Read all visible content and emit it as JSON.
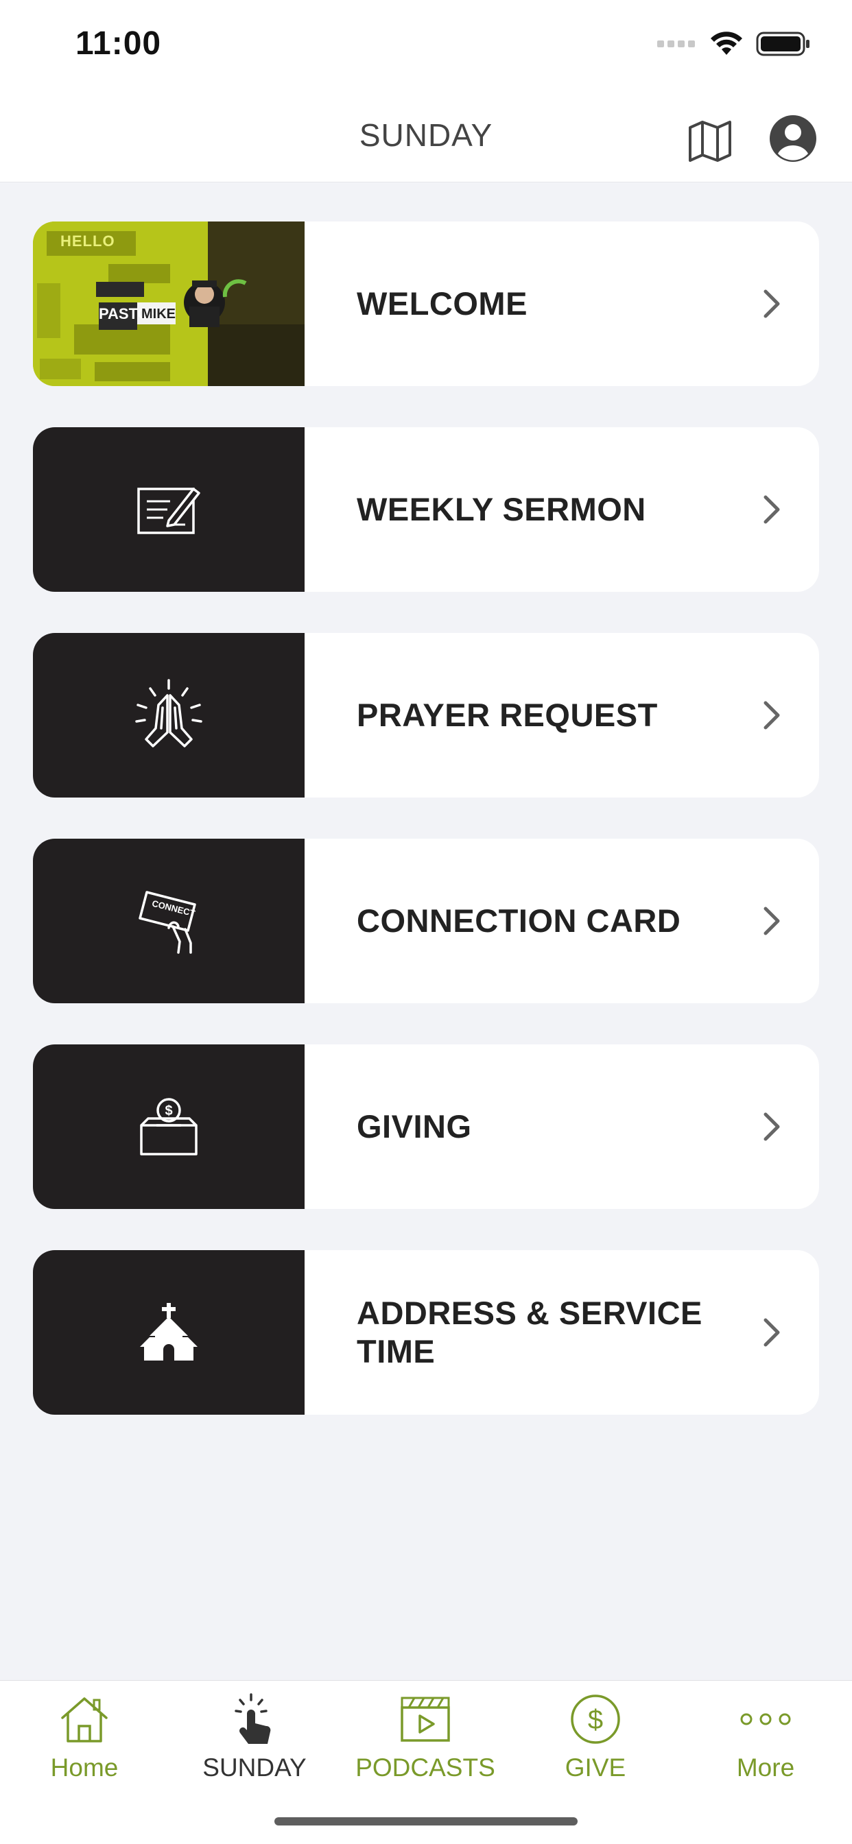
{
  "status_bar": {
    "time": "11:00"
  },
  "nav": {
    "title": "SUNDAY"
  },
  "menu": {
    "items": [
      {
        "label": "WELCOME",
        "icon": "welcome-video-thumbnail"
      },
      {
        "label": "WEEKLY SERMON",
        "icon": "notepad-pen-icon"
      },
      {
        "label": "PRAYER REQUEST",
        "icon": "praying-hands-icon"
      },
      {
        "label": "CONNECTION CARD",
        "icon": "connect-card-icon"
      },
      {
        "label": "GIVING",
        "icon": "donation-box-icon"
      },
      {
        "label": "ADDRESS & SERVICE TIME",
        "icon": "church-icon"
      }
    ],
    "welcome_thumbnail": {
      "word": "HELLO",
      "pastor": "PASTOR",
      "name": "MIKE"
    }
  },
  "tabs": [
    {
      "label": "Home",
      "icon": "home-icon",
      "active": false
    },
    {
      "label": "SUNDAY",
      "icon": "tap-hand-icon",
      "active": true
    },
    {
      "label": "PODCASTS",
      "icon": "video-clapper-icon",
      "active": false
    },
    {
      "label": "GIVE",
      "icon": "dollar-circle-icon",
      "active": false
    },
    {
      "label": "More",
      "icon": "more-dots-icon",
      "active": false
    }
  ],
  "colors": {
    "accent": "#7a9a2a",
    "thumb_bg": "#221f20",
    "welcome_bg": "#b6c51a",
    "page_bg": "#f2f3f7"
  }
}
